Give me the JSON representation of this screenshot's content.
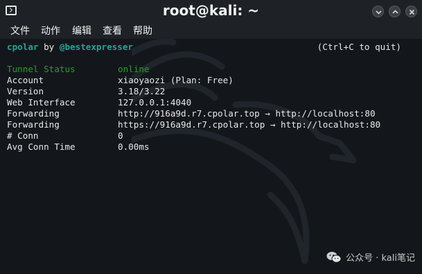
{
  "window": {
    "title": "root@kali: ~"
  },
  "menu": [
    "文件",
    "动作",
    "编辑",
    "查看",
    "帮助"
  ],
  "header": {
    "app": "cpolar",
    "by": "by",
    "author": "@bestexpresser",
    "quit_hint": "(Ctrl+C to quit)"
  },
  "status": {
    "label": "Tunnel Status",
    "value": "online"
  },
  "rows": [
    {
      "label": "Account",
      "value": "xiaoyaozi (Plan: Free)"
    },
    {
      "label": "Version",
      "value": "3.18/3.22"
    },
    {
      "label": "Web Interface",
      "value": "127.0.0.1:4040"
    },
    {
      "label": "Forwarding",
      "value": "http://916a9d.r7.cpolar.top → http://localhost:80"
    },
    {
      "label": "Forwarding",
      "value": "https://916a9d.r7.cpolar.top → http://localhost:80"
    },
    {
      "label": "# Conn",
      "value": "0"
    },
    {
      "label": "Avg Conn Time",
      "value": "0.00ms"
    }
  ],
  "watermark": "公众号 · kali笔记",
  "colors": {
    "accent_teal": "#2aa198",
    "status_green": "#2a9d2a",
    "background": "#13171b"
  }
}
